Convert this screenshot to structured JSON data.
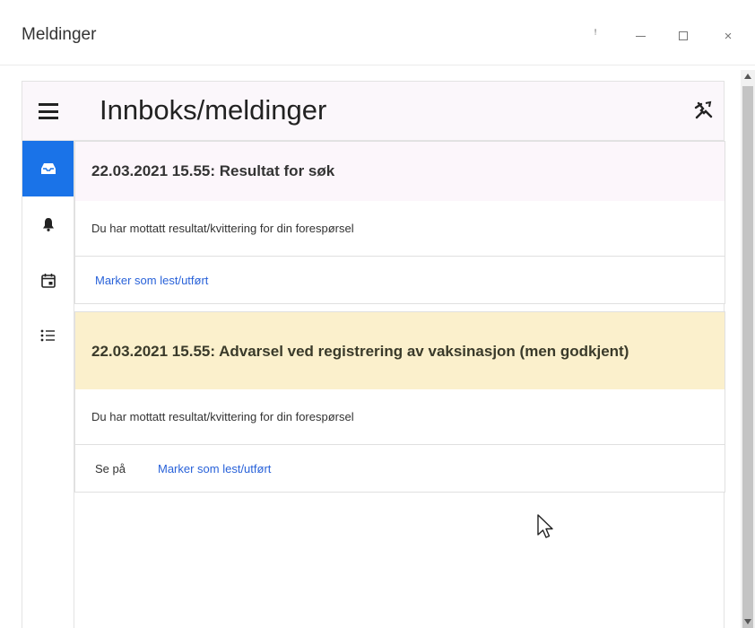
{
  "window": {
    "title": "Meldinger",
    "controls": {
      "pin_glyph": "ꜝ",
      "close_glyph": "×"
    }
  },
  "header": {
    "title": "Innboks/meldinger",
    "menu_icon": "hamburger-icon",
    "right_icon": "unpin-icon"
  },
  "sidebar": {
    "items": [
      {
        "icon": "inbox-icon",
        "active": true
      },
      {
        "icon": "bell-icon",
        "active": false
      },
      {
        "icon": "calendar-icon",
        "active": false
      },
      {
        "icon": "list-icon",
        "active": false
      }
    ],
    "active_color": "#1a73e8"
  },
  "messages": [
    {
      "type": "info",
      "title": "22.03.2021 15.55: Resultat for søk",
      "body": "Du har mottatt resultat/kvittering for din forespørsel",
      "actions": {
        "mark_read": "Marker som lest/utført"
      }
    },
    {
      "type": "warning",
      "title": "22.03.2021 15.55: Advarsel ved registrering av vaksinasjon (men godkjent)",
      "body": "Du har mottatt resultat/kvittering for din forespørsel",
      "actions": {
        "view": "Se på",
        "mark_read": "Marker som lest/utført"
      }
    }
  ],
  "colors": {
    "link": "#2962d9",
    "warning_bg": "#fbf0cc",
    "info_bg": "#fcf6fb"
  }
}
